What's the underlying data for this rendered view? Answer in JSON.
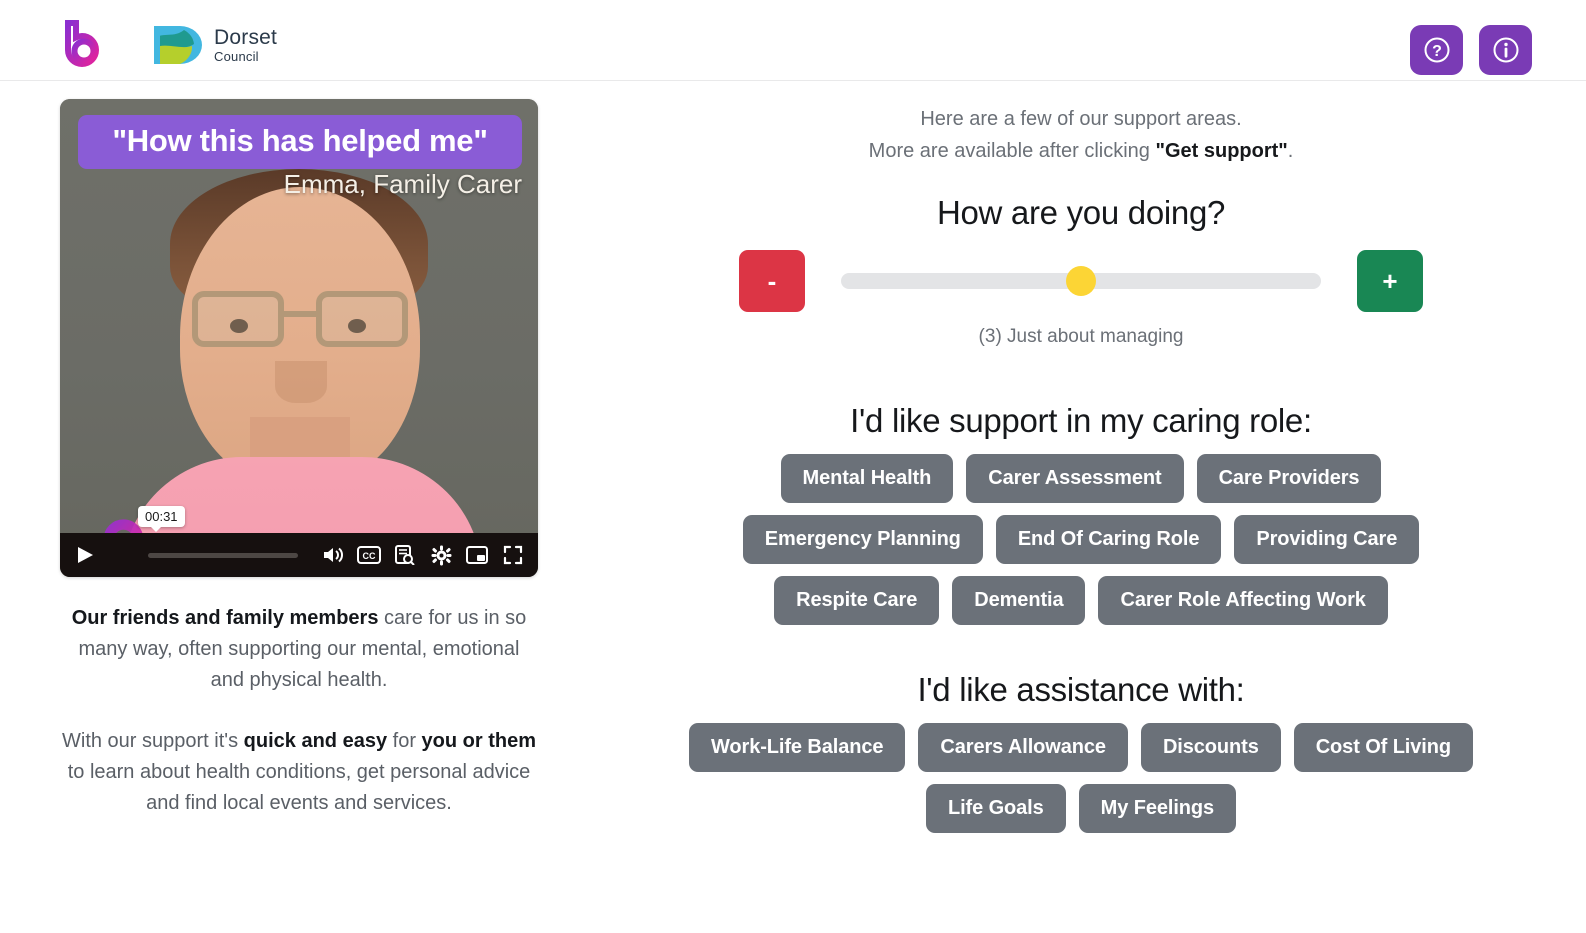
{
  "header": {
    "brand_icon": "brand-b-icon",
    "council_name_line1": "Dorset",
    "council_name_line2": "Council",
    "help_icon": "question-mark-circle-icon",
    "info_icon": "info-circle-icon",
    "accent_purple": "#7a3bb5"
  },
  "video": {
    "title": "\"How this has helped me\"",
    "subtitle": "Emma, Family Carer",
    "current_time": "00:31",
    "title_banner_color": "#8a5cd6",
    "controls": {
      "play": "play-icon",
      "volume": "volume-icon",
      "captions": "cc-icon",
      "transcript": "transcript-search-icon",
      "settings": "gear-icon",
      "picture_in_picture": "picture-in-picture-icon",
      "fullscreen": "fullscreen-icon"
    }
  },
  "left_text": {
    "p1_bold": "Our friends and family members",
    "p1_rest": " care for us in so many way, often supporting our mental, emotional and physical health.",
    "p2_a": "With our support it's ",
    "p2_b1": "quick and easy",
    "p2_c": " for ",
    "p2_b2": "you or them",
    "p2_d": " to learn about health conditions, get personal advice and find local events and services."
  },
  "intro": {
    "line1": "Here are a few of our support areas.",
    "line2_a": "More are available after clicking ",
    "line2_b": "\"Get support\"",
    "line2_c": "."
  },
  "mood": {
    "question": "How are you doing?",
    "decrease_label": "-",
    "increase_label": "+",
    "value": 3,
    "value_label": "(3) Just about managing",
    "thumb_color": "#fcd535",
    "track_color": "#e3e4e6",
    "minus_color": "#dc3545",
    "plus_color": "#198754",
    "thumb_percent": 50
  },
  "caring_role": {
    "title": "I'd like support in my caring role:",
    "rows": [
      [
        "Mental Health",
        "Carer Assessment",
        "Care Providers"
      ],
      [
        "Emergency Planning",
        "End Of Caring Role",
        "Providing Care"
      ],
      [
        "Respite Care",
        "Dementia",
        "Carer Role Affecting Work"
      ]
    ]
  },
  "assistance": {
    "title": "I'd like assistance with:",
    "rows": [
      [
        "Work-Life Balance",
        "Carers Allowance",
        "Discounts",
        "Cost Of Living"
      ],
      [
        "Life Goals",
        "My Feelings"
      ]
    ]
  },
  "colors": {
    "chip": "#6b7179",
    "text_muted": "#6b7077",
    "text_dark": "#16181b"
  }
}
